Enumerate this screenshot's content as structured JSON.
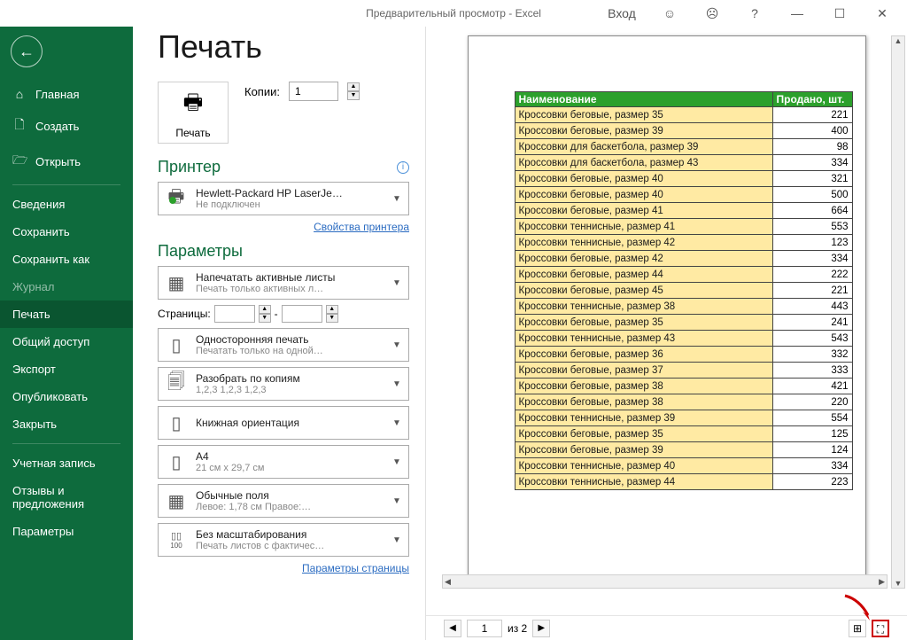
{
  "titlebar": {
    "title": "Предварительный просмотр  -  Excel",
    "login": "Вход"
  },
  "sidebar": {
    "items": [
      {
        "label": "Главная"
      },
      {
        "label": "Создать"
      },
      {
        "label": "Открыть"
      },
      {
        "label": "Сведения"
      },
      {
        "label": "Сохранить"
      },
      {
        "label": "Сохранить как"
      },
      {
        "label": "Журнал"
      },
      {
        "label": "Печать"
      },
      {
        "label": "Общий доступ"
      },
      {
        "label": "Экспорт"
      },
      {
        "label": "Опубликовать"
      },
      {
        "label": "Закрыть"
      },
      {
        "label": "Учетная запись"
      },
      {
        "label": "Отзывы и предложения"
      },
      {
        "label": "Параметры"
      }
    ]
  },
  "print": {
    "heading": "Печать",
    "button": "Печать",
    "copies_label": "Копии:",
    "copies_value": "1",
    "printer_heading": "Принтер",
    "printer_name": "Hewlett-Packard HP LaserJe…",
    "printer_status": "Не подключен",
    "printer_props": "Свойства принтера",
    "params_heading": "Параметры",
    "active_sheets": {
      "l1": "Напечатать активные листы",
      "l2": "Печать только активных л…"
    },
    "pages_label": "Страницы:",
    "pages_sep": "-",
    "one_sided": {
      "l1": "Односторонняя печать",
      "l2": "Печатать только на одной…"
    },
    "collate": {
      "l1": "Разобрать по копиям",
      "l2": "1,2,3   1,2,3   1,2,3"
    },
    "orientation": {
      "l1": "Книжная ориентация",
      "l2": ""
    },
    "paper": {
      "l1": "A4",
      "l2": "21 см x 29,7 см"
    },
    "margins": {
      "l1": "Обычные поля",
      "l2": "Левое:  1,78 см   Правое:…"
    },
    "scaling": {
      "l1": "Без масштабирования",
      "l2": "Печать листов с фактичес…"
    },
    "page_setup": "Параметры страницы"
  },
  "preview": {
    "header": {
      "col1": "Наименование",
      "col2": "Продано, шт."
    },
    "rows": [
      {
        "name": "Кроссовки беговые, размер 35",
        "val": "221"
      },
      {
        "name": "Кроссовки беговые, размер 39",
        "val": "400"
      },
      {
        "name": "Кроссовки для баскетбола, размер 39",
        "val": "98"
      },
      {
        "name": "Кроссовки для баскетбола, размер 43",
        "val": "334"
      },
      {
        "name": "Кроссовки беговые, размер 40",
        "val": "321"
      },
      {
        "name": "Кроссовки беговые, размер 40",
        "val": "500"
      },
      {
        "name": "Кроссовки беговые, размер 41",
        "val": "664"
      },
      {
        "name": "Кроссовки теннисные, размер 41",
        "val": "553"
      },
      {
        "name": "Кроссовки теннисные, размер 42",
        "val": "123"
      },
      {
        "name": "Кроссовки беговые, размер 42",
        "val": "334"
      },
      {
        "name": "Кроссовки беговые, размер 44",
        "val": "222"
      },
      {
        "name": "Кроссовки беговые, размер 45",
        "val": "221"
      },
      {
        "name": "Кроссовки теннисные, размер 38",
        "val": "443"
      },
      {
        "name": "Кроссовки беговые, размер 35",
        "val": "241"
      },
      {
        "name": "Кроссовки теннисные, размер 43",
        "val": "543"
      },
      {
        "name": "Кроссовки беговые, размер 36",
        "val": "332"
      },
      {
        "name": "Кроссовки беговые, размер 37",
        "val": "333"
      },
      {
        "name": "Кроссовки беговые, размер 38",
        "val": "421"
      },
      {
        "name": "Кроссовки беговые, размер 38",
        "val": "220"
      },
      {
        "name": "Кроссовки теннисные, размер 39",
        "val": "554"
      },
      {
        "name": "Кроссовки беговые, размер 35",
        "val": "125"
      },
      {
        "name": "Кроссовки беговые, размер 39",
        "val": "124"
      },
      {
        "name": "Кроссовки теннисные, размер 40",
        "val": "334"
      },
      {
        "name": "Кроссовки теннисные, размер 44",
        "val": "223"
      }
    ],
    "footer": {
      "page": "1",
      "of": "из 2"
    }
  }
}
